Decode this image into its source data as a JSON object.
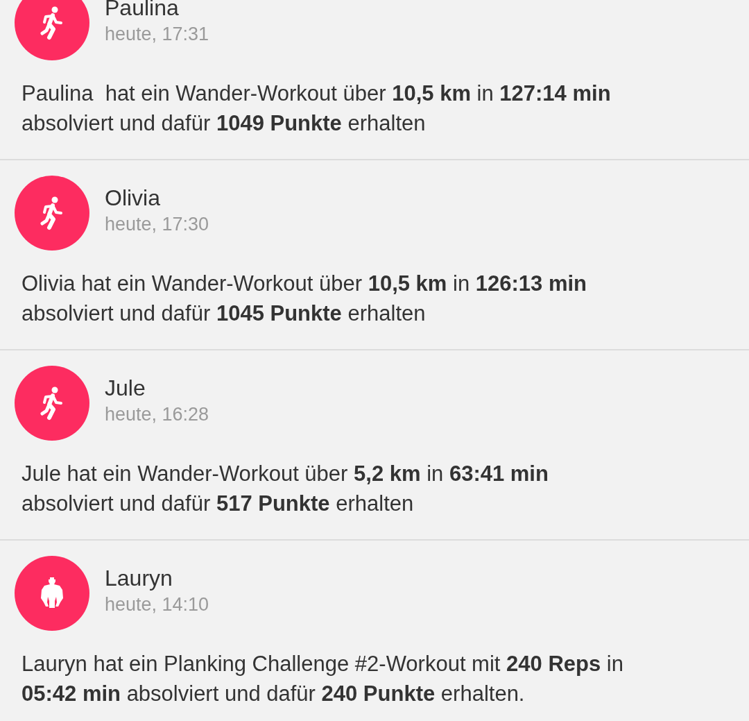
{
  "feed": [
    {
      "kind": "running",
      "name": "Paulina",
      "time": "heute, 17:31",
      "message": "Paulina  hat ein Wander-Workout über **10,5 km** in **127:14 min** absolviert und dafür **1049 Punkte** erhalten"
    },
    {
      "kind": "running",
      "name": "Olivia",
      "time": "heute, 17:30",
      "message": "Olivia hat ein Wander-Workout über **10,5 km** in **126:13 min** absolviert und dafür **1045 Punkte** erhalten"
    },
    {
      "kind": "running",
      "name": "Jule",
      "time": "heute, 16:28",
      "message": "Jule hat ein Wander-Workout über **5,2 km** in **63:41 min** absolviert und dafür **517 Punkte** erhalten"
    },
    {
      "kind": "bodyweight",
      "name": "Lauryn",
      "time": "heute, 14:10",
      "message": "Lauryn hat ein Planking Challenge #2-Workout mit **240 Reps** in **05:42 min** absolviert und dafür **240 Punkte** erhalten."
    }
  ]
}
